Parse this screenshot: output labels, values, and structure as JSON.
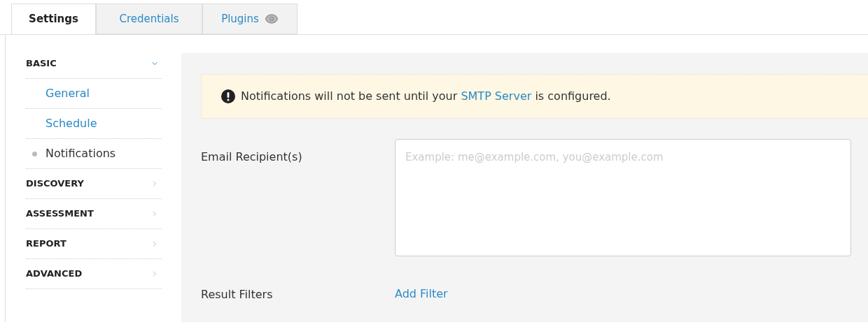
{
  "tabs": [
    {
      "label": "Settings",
      "selected": true
    },
    {
      "label": "Credentials",
      "selected": false
    },
    {
      "label": "Plugins",
      "selected": false
    }
  ],
  "sidebar": {
    "sections": [
      {
        "label": "BASIC",
        "expanded": true,
        "children": [
          {
            "label": "General",
            "selected": false
          },
          {
            "label": "Schedule",
            "selected": false
          },
          {
            "label": "Notifications",
            "selected": true
          }
        ]
      },
      {
        "label": "DISCOVERY",
        "expanded": false
      },
      {
        "label": "ASSESSMENT",
        "expanded": false
      },
      {
        "label": "REPORT",
        "expanded": false
      },
      {
        "label": "ADVANCED",
        "expanded": false
      }
    ]
  },
  "notice": {
    "text_before": "Notifications will not be sent until your",
    "link": "SMTP Server",
    "text_after": "is configured."
  },
  "form": {
    "email_label": "Email Recipient(s)",
    "email_placeholder": "Example: me@example.com, you@example.com",
    "filters_label": "Result Filters",
    "add_filter": "Add Filter"
  }
}
